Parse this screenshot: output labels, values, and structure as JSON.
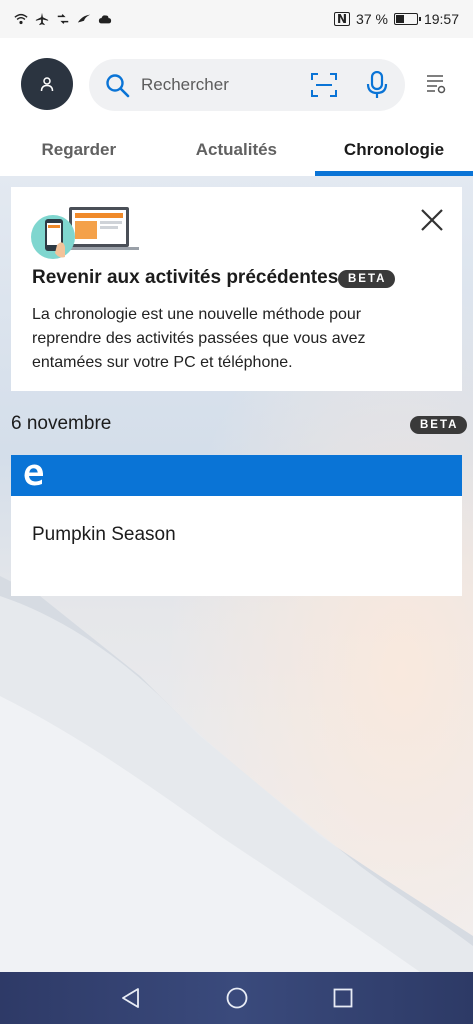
{
  "status_bar": {
    "battery_percent": "37 %",
    "battery_level": 0.37,
    "time": "19:57",
    "icons": [
      "wifi-icon",
      "airplane-icon",
      "data-saver-icon",
      "swift-icon",
      "cloud-icon",
      "nfc-icon",
      "battery-icon"
    ]
  },
  "header": {
    "search": {
      "placeholder": "Rechercher"
    },
    "tabs": [
      {
        "label": "Regarder",
        "active": false
      },
      {
        "label": "Actualités",
        "active": false
      },
      {
        "label": "Chronologie",
        "active": true
      }
    ],
    "accent_color": "#0a74d6"
  },
  "promo": {
    "title": "Revenir aux activités précédentes",
    "badge": "BETA",
    "body": "La chronologie est une nouvelle méthode pour reprendre des activités passées que vous avez entamées sur votre PC et téléphone."
  },
  "timeline": {
    "date": "6 novembre",
    "badge": "BETA",
    "activities": [
      {
        "app_icon": "edge-icon",
        "title": "Pumpkin Season"
      }
    ]
  },
  "nav_bar": {
    "buttons": [
      "back-icon",
      "home-icon",
      "recents-icon"
    ]
  }
}
